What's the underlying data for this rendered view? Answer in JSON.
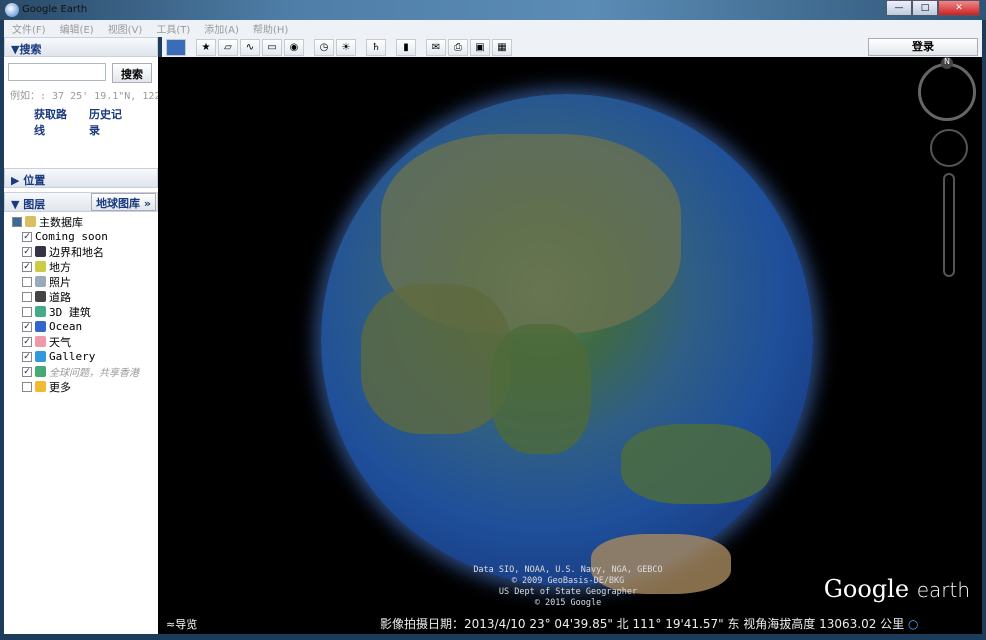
{
  "title": "Google Earth",
  "menu": [
    "文件(F)",
    "编辑(E)",
    "视图(V)",
    "工具(T)",
    "添加(A)",
    "帮助(H)"
  ],
  "search": {
    "header": "▼搜索",
    "button": "搜索",
    "value": "",
    "example": "例如：: 37 25' 19.1\"N, 122",
    "directions": "获取路线",
    "history": "历史记录"
  },
  "places": {
    "header": "▶ 位置"
  },
  "layers": {
    "header": "▼ 图层",
    "gallery_button": "地球图库 »",
    "items": [
      {
        "label": "主数据库",
        "checked": "partial",
        "color": "#d8c060"
      },
      {
        "label": "Coming soon",
        "checked": true,
        "color": ""
      },
      {
        "label": "边界和地名",
        "checked": true,
        "color": "#334"
      },
      {
        "label": "地方",
        "checked": true,
        "color": "#cc4"
      },
      {
        "label": "照片",
        "checked": false,
        "color": "#9ab"
      },
      {
        "label": "道路",
        "checked": false,
        "color": "#444"
      },
      {
        "label": "3D 建筑",
        "checked": false,
        "color": "#4a8"
      },
      {
        "label": "Ocean",
        "checked": true,
        "color": "#36c"
      },
      {
        "label": "天气",
        "checked": true,
        "color": "#e9a"
      },
      {
        "label": "Gallery",
        "checked": true,
        "color": "#39d"
      },
      {
        "label": "全球问题，共享香港",
        "checked": true,
        "color": "#4a7"
      },
      {
        "label": "更多",
        "checked": false,
        "color": "#eb3"
      }
    ]
  },
  "toolbar": {
    "login": "登录"
  },
  "viewer": {
    "attribution": [
      "Data SIO, NOAA, U.S. Navy, NGA, GEBCO",
      "© 2009 GeoBasis-DE/BKG",
      "US Dept of State Geographer",
      "© 2015 Google"
    ],
    "brand_google": "Google",
    "brand_earth": "earth",
    "nav": "≈导览",
    "compass_n": "N",
    "status": "影像拍摄日期：2013/4/10   23° 04'39.85\" 北 111° 19'41.57\" 东 视角海拔高度 13063.02 公里"
  }
}
